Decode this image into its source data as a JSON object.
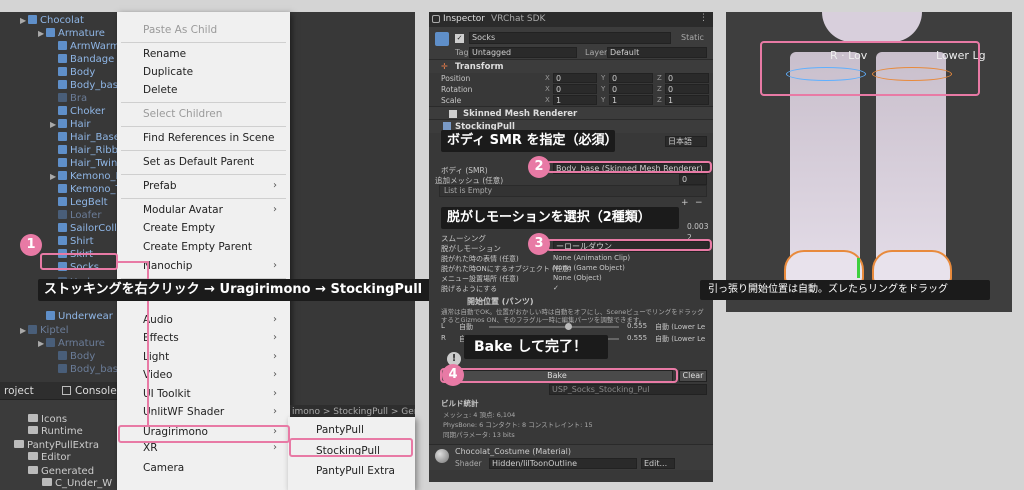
{
  "hierarchy": {
    "items": [
      {
        "label": "Chocolat",
        "dim": false
      },
      {
        "label": "Armature",
        "dim": false
      },
      {
        "label": "ArmWarmer",
        "dim": false
      },
      {
        "label": "Bandage",
        "dim": false
      },
      {
        "label": "Body",
        "dim": false
      },
      {
        "label": "Body_base",
        "dim": false
      },
      {
        "label": "Bra",
        "dim": true
      },
      {
        "label": "Choker",
        "dim": false
      },
      {
        "label": "Hair",
        "dim": false
      },
      {
        "label": "Hair_Base",
        "dim": false
      },
      {
        "label": "Hair_Ribbon",
        "dim": false
      },
      {
        "label": "Hair_TwinT",
        "dim": false
      },
      {
        "label": "Kemono_E",
        "dim": false
      },
      {
        "label": "Kemono_T",
        "dim": false
      },
      {
        "label": "LegBelt",
        "dim": false
      },
      {
        "label": "Loafer",
        "dim": true
      },
      {
        "label": "SailorColla",
        "dim": false
      },
      {
        "label": "Shirt",
        "dim": false
      },
      {
        "label": "Skirt",
        "dim": false
      },
      {
        "label": "Socks",
        "dim": false
      },
      {
        "label": "Underwear",
        "dim": true
      },
      {
        "label": "Underwear",
        "dim": false
      },
      {
        "label": "Kiptel",
        "dim": true
      },
      {
        "label": "Armature",
        "dim": true
      },
      {
        "label": "Body",
        "dim": true
      },
      {
        "label": "Body_base",
        "dim": true
      }
    ]
  },
  "context_menu": {
    "items": [
      {
        "label": "Paste As Child",
        "disabled": true,
        "arrow": false
      },
      {
        "label": "Rename",
        "disabled": false,
        "arrow": false
      },
      {
        "label": "Duplicate",
        "disabled": false,
        "arrow": false
      },
      {
        "label": "Delete",
        "disabled": false,
        "arrow": false
      },
      {
        "label": "Select Children",
        "disabled": true,
        "arrow": false
      },
      {
        "label": "Find References in Scene",
        "disabled": false,
        "arrow": false
      },
      {
        "label": "Set as Default Parent",
        "disabled": false,
        "arrow": false
      },
      {
        "label": "Prefab",
        "disabled": false,
        "arrow": true
      },
      {
        "label": "Modular Avatar",
        "disabled": false,
        "arrow": true
      },
      {
        "label": "Create Empty",
        "disabled": false,
        "arrow": false
      },
      {
        "label": "Create Empty Parent",
        "disabled": false,
        "arrow": false
      },
      {
        "label": "Nanochip",
        "disabled": false,
        "arrow": true
      },
      {
        "label": "3D Object",
        "disabled": false,
        "arrow": true
      },
      {
        "label": "Audio",
        "disabled": false,
        "arrow": true
      },
      {
        "label": "Effects",
        "disabled": false,
        "arrow": true
      },
      {
        "label": "Light",
        "disabled": false,
        "arrow": true
      },
      {
        "label": "Video",
        "disabled": false,
        "arrow": true
      },
      {
        "label": "UI Toolkit",
        "disabled": false,
        "arrow": true
      },
      {
        "label": "UnlitWF Shader",
        "disabled": false,
        "arrow": true
      },
      {
        "label": "Uragirimono",
        "disabled": false,
        "arrow": true
      },
      {
        "label": "XR",
        "disabled": false,
        "arrow": true
      },
      {
        "label": "Camera",
        "disabled": false,
        "arrow": false
      }
    ],
    "submenu": [
      "PantyPull",
      "StockingPull",
      "PantyPull Extra"
    ]
  },
  "project": {
    "tabs": [
      "roject",
      "Console"
    ],
    "path": "imono > StockingPull > Ger",
    "folders": [
      "Icons",
      "Runtime",
      "PantyPullExtra",
      "Editor",
      "Generated",
      "C_Under_W"
    ]
  },
  "inspector": {
    "tabs": [
      "Inspector",
      "VRChat SDK"
    ],
    "object_name": "Socks",
    "static_label": "Static",
    "tag_label": "Tag",
    "tag_value": "Untagged",
    "layer_label": "Layer",
    "layer_value": "Default",
    "transform": {
      "title": "Transform",
      "rows": [
        {
          "label": "Position",
          "x": "0",
          "y": "0",
          "z": "0"
        },
        {
          "label": "Rotation",
          "x": "0",
          "y": "0",
          "z": "0"
        },
        {
          "label": "Scale",
          "x": "1",
          "y": "1",
          "z": "1"
        }
      ]
    },
    "smr_title": "Skinned Mesh Renderer",
    "stocking_title": "StockingPull",
    "language": "日本語",
    "body_label": "ボディ (SMR)",
    "body_value": "Body_base (Skinned Mesh Renderer)",
    "extra_mesh_label": "追加メッシュ (任意)",
    "list_empty": "List is Empty",
    "list_count": "0",
    "smooth_label": "スムーシング",
    "smooth_val1": "0.003",
    "smooth_val2": "2",
    "motion_label": "脱がしモーション",
    "motion_value": "ーロールダウン",
    "rows": [
      {
        "label": "脱がれた時の表情 (任意)",
        "value": "None (Animation Clip)"
      },
      {
        "label": "脱がれた時ONにするオブジェクト (任意)",
        "value": "None (Game Object)"
      },
      {
        "label": "メニュー設置場所 (任意)",
        "value": "None (Object)"
      },
      {
        "label": "脱げるようにする",
        "value": "✓"
      }
    ],
    "grab_title": "開始位置 (パンツ)",
    "grab_desc": "通常は自動でOK。位置がおかしい時は自動をオフにし、SceneビューでリングをドラッグするとGizmos ON、そのフラグル一時に編集パーツを調整できます。",
    "grab_rows": [
      {
        "label": "L",
        "auto": "自動",
        "value": "0.555",
        "mode": "自動 (Lower Le"
      },
      {
        "label": "R",
        "auto": "自動",
        "value": "0.555",
        "mode": "自動 (Lower Le"
      }
    ],
    "bake_label": "Bake",
    "clear_label": "Clear",
    "output_value": "USP_Socks_Stocking_Pul",
    "build_title": "ビルド統計",
    "build_stats": [
      "メッシュ: 4 頂点: 6,104",
      "PhysBone: 6 コンタクト: 8 コンストレイント: 15",
      "同期パラメータ: 13 bits"
    ],
    "material_title": "Chocolat_Costume (Material)",
    "shader_label": "Shader",
    "shader_value": "Hidden/lilToonOutline",
    "edit_label": "Edit..."
  },
  "scene": {
    "overlay_left": "R · Lov",
    "overlay_right": "Lower Lg"
  },
  "callouts": {
    "c1": "ストッキングを右クリック → Uragirimono → StockingPull",
    "c2": "ボディ SMR を指定（必須）",
    "c3": "脱がしモーションを選択（2種類）",
    "c4": "Bake して完了！",
    "scene_note": "引っ張り開始位置は自動。ズレたらリングをドラッグ"
  },
  "steps": [
    "1",
    "2",
    "3",
    "4"
  ],
  "colors": {
    "accent": "#e87aa5",
    "hierarchy_text": "#8fb6e6",
    "dark_bg": "#383838"
  }
}
